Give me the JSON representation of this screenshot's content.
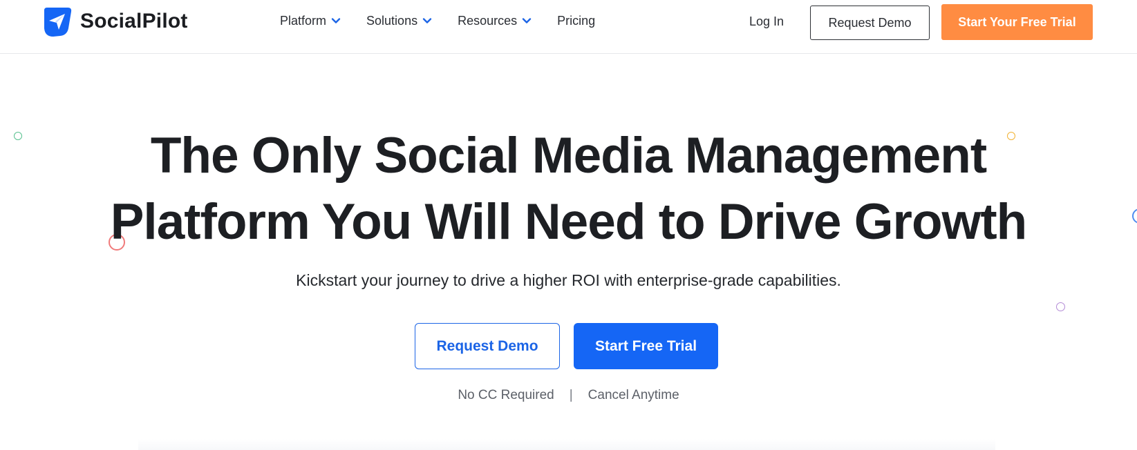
{
  "brand": {
    "name": "SocialPilot",
    "logo_icon": "paper-plane-icon",
    "accent_blue": "#1566f5",
    "accent_orange": "#ff8c42"
  },
  "nav": {
    "items": [
      {
        "label": "Platform",
        "has_dropdown": true
      },
      {
        "label": "Solutions",
        "has_dropdown": true
      },
      {
        "label": "Resources",
        "has_dropdown": true
      },
      {
        "label": "Pricing",
        "has_dropdown": false
      }
    ],
    "dropdown_icon": "chevron-down-icon"
  },
  "header_actions": {
    "login_label": "Log In",
    "demo_label": "Request Demo",
    "trial_label": "Start Your Free Trial"
  },
  "hero": {
    "title_line1": "The Only Social Media Management",
    "title_line2": "Platform You Will Need to Drive Growth",
    "subtitle": "Kickstart your journey to drive a higher ROI with enterprise-grade capabilities.",
    "demo_label": "Request Demo",
    "trial_label": "Start Free Trial",
    "note_left": "No CC Required",
    "note_separator": "|",
    "note_right": "Cancel Anytime"
  }
}
